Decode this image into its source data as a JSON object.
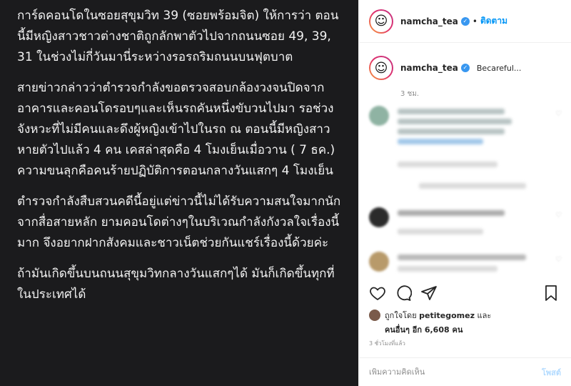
{
  "post": {
    "paragraphs": [
      "การ์ดคอนโดในซอยสุขุมวิท 39 (ซอยพร้อมจิต) ให้การว่า ตอนนี้มีหญิงสาวชาวต่างชาติถูกลักพาตัวไปจากถนนซอย 49, 39, 31 ในช่วงไม่กี่วันมานี่ระหว่างรอรถริมถนนบนฟุตบาต",
      "สายข่าวกล่าวว่าตำรวจกำลังขอตรวจสอบกล้องวงจนปิดจากอาคารและคอนโดรอบๆและเห็นรถคันหนึ่งขับวนไปมา รอช่วงจังหวะที่ไม่มีคนและดึงผู้หญิงเข้าไปในรถ ณ ตอนนี้มีหญิงสาวหายตัวไปแล้ว 4 คน เคสล่าสุดคือ 4 โมงเย็นเมื่อวาน ( 7 ธค.) ความขนลุกคือคนร้ายปฏิบัติการตอนกลางวันแสกๆ 4 โมงเย็น",
      "ตำรวจกำลังสืบสวนคดีนี้อยู่แต่ข่าวนี้ไม่ได้รับความสนใจมากนักจากสื่อสายหลัก ยามคอนโดต่างๆในบริเวณกำลังกังวลใจเรื่องนี้มาก จึงอยากฝากสังคมและชาวเน็ตช่วยกันแชร์เรื่องนี้ด้วยค่ะ",
      "ถ้ามันเกิดขึ้นบนถนนสุขุมวิทกลางวันแสกๆได้ มันก็เกิดขึ้นทุกที่ในประเทศได้"
    ]
  },
  "header": {
    "username": "namcha_tea",
    "separator": "•",
    "follow_label": "ติดตาม",
    "avatar_face": "☺"
  },
  "caption": {
    "username": "namcha_tea",
    "text": "Becareful...",
    "time": "3 ชม."
  },
  "likes": {
    "prefix": "ถูกใจโดย",
    "liker": "petitegomez",
    "conj": "และ",
    "others_label": "คนอื่นๆ อีก 6,608 คน"
  },
  "timestamp": "3 ชั่วโมงที่แล้ว",
  "comment_box": {
    "placeholder": "เพิ่มความคิดเห็น",
    "post_label": "โพสต์"
  },
  "colors": {
    "post_bg": "#1b1b1d",
    "accent": "#0095f6",
    "verified": "#3897f0"
  },
  "icons": [
    "heart-icon",
    "comment-icon",
    "share-icon",
    "bookmark-icon",
    "verified-icon"
  ]
}
